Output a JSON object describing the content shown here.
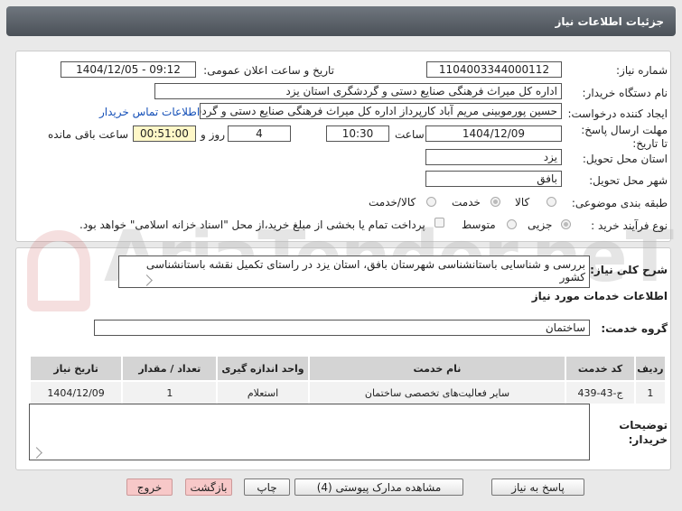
{
  "header": {
    "title": "جزئیات اطلاعات نیاز"
  },
  "watermark": {
    "text": "AriaTender.neT"
  },
  "fields": {
    "need_number_label": "شماره نیاز:",
    "need_number": "1104003344000112",
    "announce_label": "تاریخ و ساعت اعلان عمومی:",
    "announce_value": "1404/12/05 - 09:12",
    "buyer_org_label": "نام دستگاه خریدار:",
    "buyer_org": "اداره کل میراث فرهنگی  صنایع دستی و گردشگری استان یزد",
    "requester_label": "ایجاد کننده درخواست:",
    "requester": "حسین پورموبینی مریم آباد کارپرداز اداره کل میراث فرهنگی  صنایع دستی و گردشگری",
    "contact_link": "اطلاعات تماس خریدار",
    "deadline_label": "مهلت ارسال پاسخ: تا تاریخ:",
    "deadline_date": "1404/12/09",
    "time_label": "ساعت",
    "deadline_time": "10:30",
    "days_value": "4",
    "days_label": "روز و",
    "remaining_time": "00:51:00",
    "remaining_label": "ساعت باقی مانده",
    "province_label": "استان محل تحویل:",
    "province": "یزد",
    "city_label": "شهر محل تحویل:",
    "city": "بافق",
    "category_label": "طبقه بندی موضوعی:",
    "category_options": [
      "کالا",
      "خدمت",
      "کالا/خدمت"
    ],
    "process_label": "نوع فرآیند خرید :",
    "process_options": [
      "جزیی",
      "متوسط"
    ],
    "payment_note": "پرداخت تمام یا بخشی از مبلغ خرید،از محل \"اسناد خزانه اسلامی\" خواهد بود."
  },
  "summary": {
    "label": "شرح کلی نیاز:",
    "text": "بررسی و شناسایی باستانشناسی شهرستان بافق، استان یزد در راستای تکمیل نقشه باستانشناسی کشور"
  },
  "services": {
    "section_title": "اطلاعات خدمات مورد نیاز",
    "group_label": "گروه خدمت:",
    "group_value": "ساختمان",
    "columns": [
      "ردیف",
      "کد خدمت",
      "نام خدمت",
      "واحد اندازه گیری",
      "تعداد / مقدار",
      "تاریخ نیاز"
    ],
    "rows": [
      [
        "1",
        "ج-43-439",
        "سایر فعالیت‌های تخصصی ساختمان",
        "استعلام",
        "1",
        "1404/12/09"
      ]
    ]
  },
  "notes": {
    "label": "توضیحات خریدار:",
    "text": ""
  },
  "buttons": {
    "reply": "پاسخ به نیاز",
    "attachments": "مشاهده مدارک پیوستی (4)",
    "print": "چاپ",
    "back": "بازگشت",
    "exit": "خروج"
  }
}
